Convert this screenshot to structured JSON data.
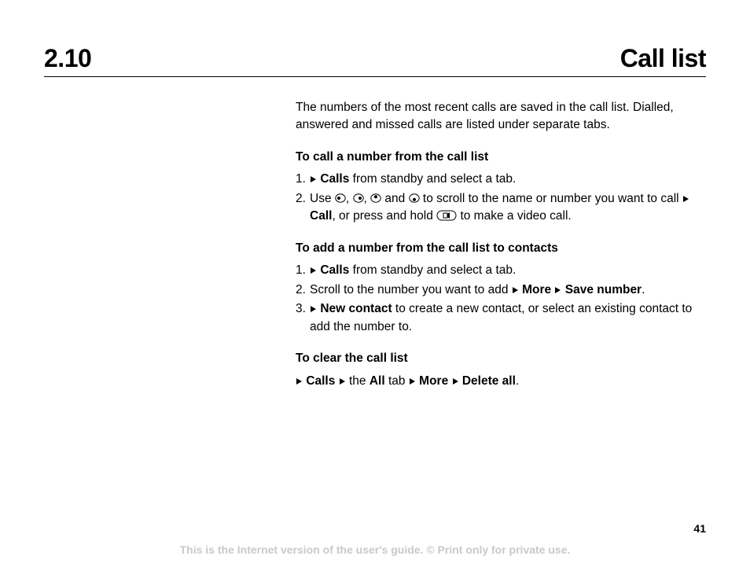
{
  "header": {
    "section_number": "2.10",
    "section_title": "Call list"
  },
  "intro": "The numbers of the most recent calls are saved in the call list. Dialled, answered and missed calls are listed under separate tabs.",
  "to_call": {
    "heading": "To call a number from the call list",
    "step1_num": "1.",
    "step1_calls": "Calls",
    "step1_rest": " from standby and select a tab.",
    "step2_num": "2.",
    "step2_use": "Use ",
    "step2_and": " and ",
    "step2_scroll": " to scroll to the name or number you want to call ",
    "step2_call": "Call",
    "step2_hold": ", or press and hold ",
    "step2_after_btn": " to make a video call."
  },
  "to_add": {
    "heading": "To add a number from the call list to contacts",
    "step1_num": "1.",
    "step1_calls": "Calls",
    "step1_rest": " from standby and select a tab.",
    "step2_num": "2.",
    "step2_text": "Scroll to the number you want to add ",
    "step2_more": "More",
    "step2_save": "Save number",
    "step2_period": ".",
    "step3_num": "3.",
    "step3_newcontact": "New contact",
    "step3_rest": " to create a new contact, or select an existing contact to add the number to."
  },
  "to_clear": {
    "heading": "To clear the call list",
    "calls": "Calls",
    "the": " the ",
    "all": "All",
    "tab": " tab ",
    "more": "More",
    "delete_all": "Delete all",
    "period": "."
  },
  "page_number": "41",
  "footer": "This is the Internet version of the user's guide. © Print only for private use."
}
